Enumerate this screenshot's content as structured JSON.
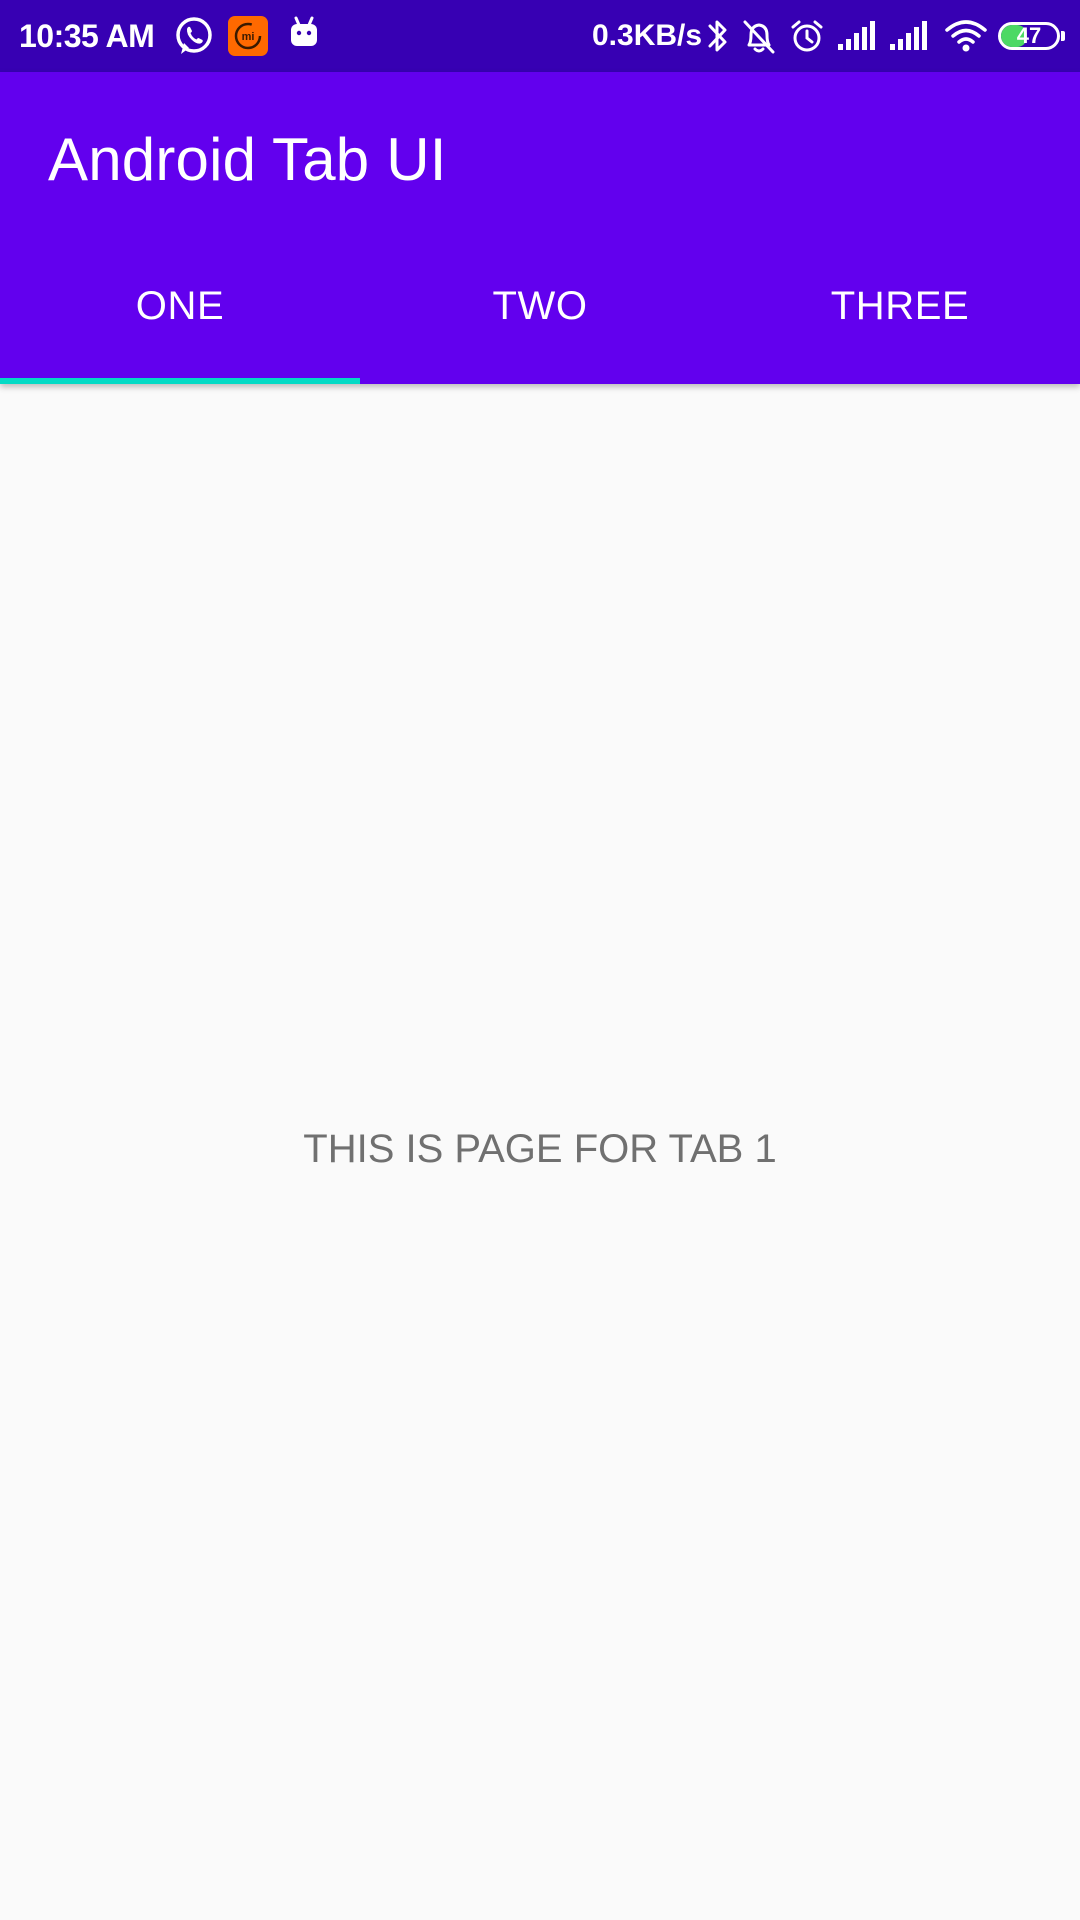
{
  "status_bar": {
    "time": "10:35 AM",
    "network_speed": "0.3KB/s",
    "battery_level": "47",
    "battery_fraction": 0.47,
    "left_icons": [
      "whatsapp-icon",
      "mi-app-icon",
      "android-robot-icon"
    ],
    "right_icons": [
      "bluetooth-icon",
      "silent-bell-icon",
      "alarm-icon",
      "signal-1-icon",
      "signal-2-icon",
      "wifi-icon",
      "battery-icon"
    ]
  },
  "app_bar": {
    "title": "Android Tab UI"
  },
  "tabs": [
    {
      "label": "ONE",
      "selected": true
    },
    {
      "label": "TWO",
      "selected": false
    },
    {
      "label": "THREE",
      "selected": false
    }
  ],
  "page": {
    "text": "THIS IS PAGE FOR TAB 1"
  },
  "colors": {
    "status_bar": "#3700b3",
    "app_bar": "#6200ee",
    "tab_indicator": "#03dac5",
    "background": "#fafafa",
    "page_text": "#707070",
    "mi_app": "#ff6900",
    "battery_fill": "#4cd964"
  }
}
